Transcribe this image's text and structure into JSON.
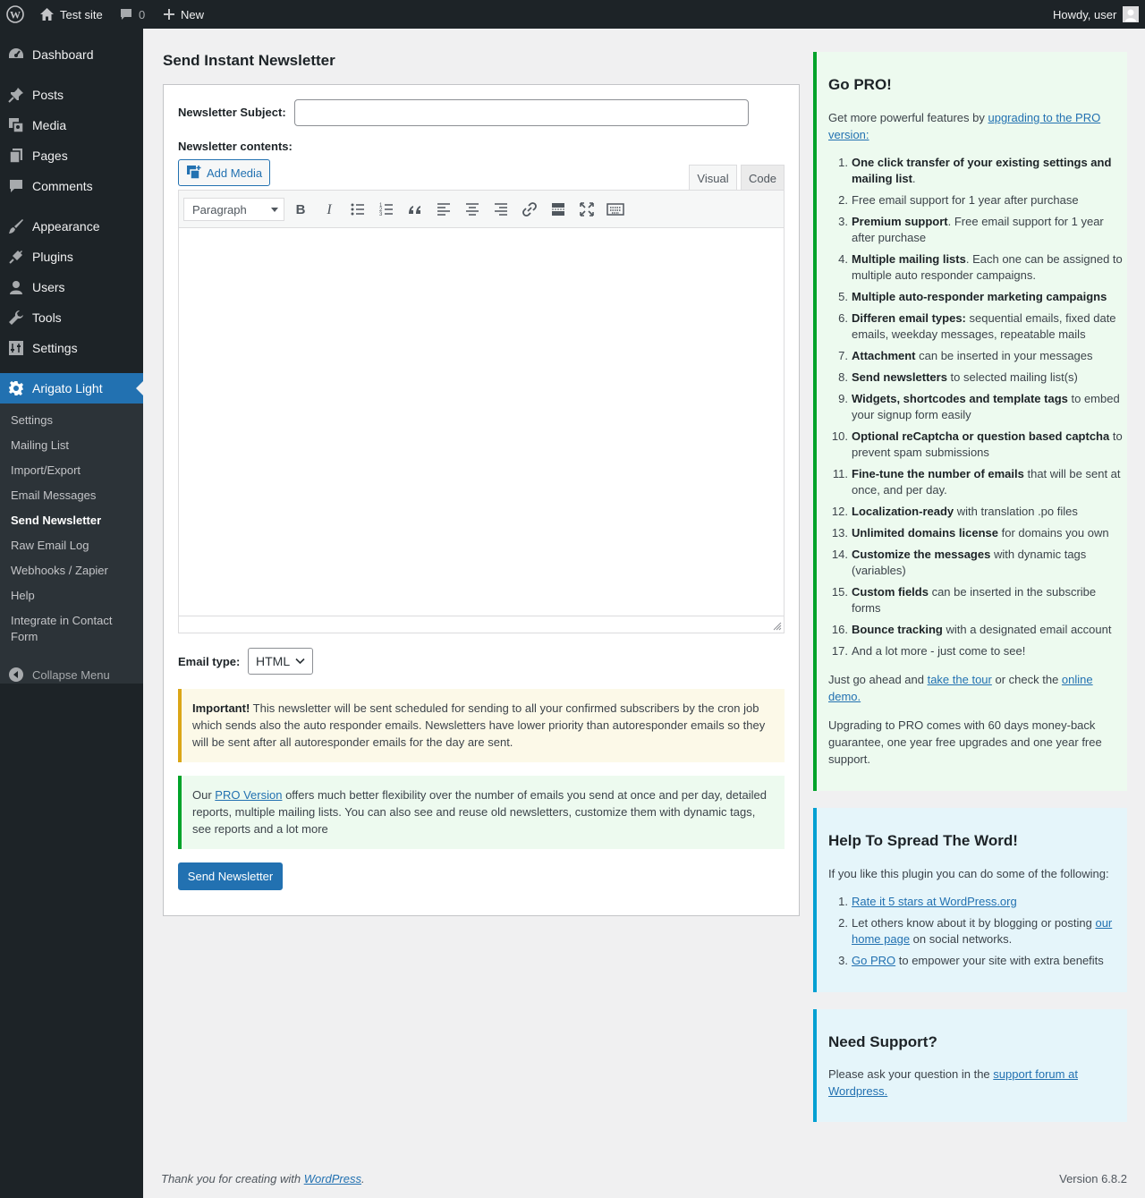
{
  "adminbar": {
    "site_name": "Test site",
    "comments_count": "0",
    "new_label": "New",
    "howdy": "Howdy, user"
  },
  "sidebar": {
    "items": [
      {
        "label": "Dashboard",
        "icon": "dashboard-icon"
      },
      {
        "label": "Posts",
        "icon": "pin-icon"
      },
      {
        "label": "Media",
        "icon": "media-icon"
      },
      {
        "label": "Pages",
        "icon": "pages-icon"
      },
      {
        "label": "Comments",
        "icon": "comments-icon"
      },
      {
        "label": "Appearance",
        "icon": "brush-icon"
      },
      {
        "label": "Plugins",
        "icon": "plug-icon"
      },
      {
        "label": "Users",
        "icon": "user-icon"
      },
      {
        "label": "Tools",
        "icon": "wrench-icon"
      },
      {
        "label": "Settings",
        "icon": "settings-icon"
      },
      {
        "label": "Arigato Light",
        "icon": "gear-icon"
      }
    ],
    "submenu": [
      "Settings",
      "Mailing List",
      "Import/Export",
      "Email Messages",
      "Send Newsletter",
      "Raw Email Log",
      "Webhooks / Zapier",
      "Help",
      "Integrate in Contact Form"
    ],
    "collapse": "Collapse Menu"
  },
  "page": {
    "title": "Send Instant Newsletter",
    "subject_label": "Newsletter Subject:",
    "subject_value": "",
    "contents_label": "Newsletter contents:",
    "add_media": "Add Media",
    "tab_visual": "Visual",
    "tab_code": "Code",
    "format_select": "Paragraph",
    "email_type_label": "Email type:",
    "email_type_value": "HTML",
    "notice_important_bold": "Important!",
    "notice_important_text": " This newsletter will be sent scheduled for sending to all your confirmed subscribers by the cron job which sends also the auto responder emails. Newsletters have lower priority than autoresponder emails so they will be sent after all autoresponder emails for the day are sent.",
    "notice_pro_prefix": "Our ",
    "notice_pro_link": "PRO Version",
    "notice_pro_text": " offers much better flexibility over the number of emails you send at once and per day, detailed reports, multiple mailing lists. You can also see and reuse old newsletters, customize them with dynamic tags, see reports and a lot more",
    "send_button": "Send Newsletter"
  },
  "gopro": {
    "title": "Go PRO!",
    "intro_prefix": "Get more powerful features by ",
    "intro_link": "upgrading to the PRO version:",
    "items": [
      {
        "n": "1.",
        "b": "One click transfer of your existing settings and mailing list",
        "t": "."
      },
      {
        "n": "2.",
        "b": "",
        "t": "Free email support for 1 year after purchase"
      },
      {
        "n": "3.",
        "b": "Premium support",
        "t": ". Free email support for 1 year after purchase"
      },
      {
        "n": "4.",
        "b": "Multiple mailing lists",
        "t": ". Each one can be assigned to multiple auto responder campaigns."
      },
      {
        "n": "5.",
        "b": "Multiple auto-responder marketing campaigns",
        "t": ""
      },
      {
        "n": "6.",
        "b": "Differen email types:",
        "t": " sequential emails, fixed date emails, weekday messages, repeatable mails"
      },
      {
        "n": "7.",
        "b": "Attachment",
        "t": " can be inserted in your messages"
      },
      {
        "n": "8.",
        "b": "Send newsletters",
        "t": " to selected mailing list(s)"
      },
      {
        "n": "9.",
        "b": "Widgets, shortcodes and template tags",
        "t": " to embed your signup form easily"
      },
      {
        "n": "10.",
        "b": "Optional reCaptcha or question based captcha",
        "t": " to prevent spam submissions"
      },
      {
        "n": "11.",
        "b": "Fine-tune the number of emails",
        "t": " that will be sent at once, and per day."
      },
      {
        "n": "12.",
        "b": "Localization-ready",
        "t": " with translation .po files"
      },
      {
        "n": "13.",
        "b": "Unlimited domains license",
        "t": " for domains you own"
      },
      {
        "n": "14.",
        "b": "Customize the messages",
        "t": " with dynamic tags (variables)"
      },
      {
        "n": "15.",
        "b": "Custom fields",
        "t": " can be inserted in the subscribe forms"
      },
      {
        "n": "16.",
        "b": "Bounce tracking",
        "t": " with a designated email account"
      },
      {
        "n": "17.",
        "b": "",
        "t": "And a lot more - just come to see!"
      }
    ],
    "tour_prefix": "Just go ahead and ",
    "tour_link": "take the tour",
    "tour_middle": " or check the ",
    "demo_link": "online demo.",
    "guarantee": "Upgrading to PRO comes with 60 days money-back guarantee, one year free upgrades and one year free support."
  },
  "spread": {
    "title": "Help To Spread The Word!",
    "intro": "If you like this plugin you can do some of the following:",
    "item1_link": "Rate it 5 stars at WordPress.org",
    "item2_prefix": "Let others know about it by blogging or posting ",
    "item2_link": "our home page",
    "item2_suffix": " on social networks.",
    "item3_link": "Go PRO",
    "item3_suffix": " to empower your site with extra benefits"
  },
  "support": {
    "title": "Need Support?",
    "prefix": "Please ask your question in the ",
    "link": "support forum at Wordpress."
  },
  "footer": {
    "thanks_prefix": "Thank you for creating with ",
    "thanks_link": "WordPress",
    "thanks_suffix": ".",
    "version": "Version 6.8.2"
  }
}
